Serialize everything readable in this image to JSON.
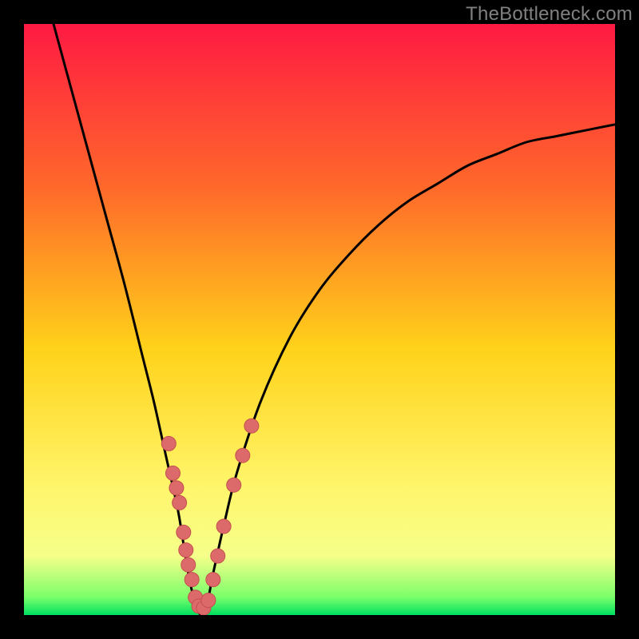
{
  "watermark": "TheBottleneck.com",
  "colors": {
    "frame": "#000000",
    "grad_top": "#ff1a43",
    "grad_upper": "#ff6a2a",
    "grad_mid": "#ffd21a",
    "grad_low": "#fff56a",
    "grad_band": "#f6ff8a",
    "grad_bottom": "#00e060",
    "curve": "#000000",
    "dot_fill": "#dd6a6a",
    "dot_stroke": "#c44f4f"
  },
  "chart_data": {
    "type": "line",
    "title": "",
    "xlabel": "",
    "ylabel": "",
    "xlim": [
      0,
      100
    ],
    "ylim": [
      0,
      100
    ],
    "series": [
      {
        "name": "bottleneck-curve",
        "x": [
          5,
          8,
          11,
          14,
          17,
          20,
          22,
          24,
          26,
          27,
          28,
          29,
          30,
          31,
          32,
          34,
          36,
          40,
          45,
          50,
          55,
          60,
          65,
          70,
          75,
          80,
          85,
          90,
          95,
          100
        ],
        "y": [
          100,
          89,
          78,
          67,
          56,
          44,
          36,
          27,
          18,
          12,
          6,
          2,
          0,
          2,
          7,
          16,
          24,
          36,
          47,
          55,
          61,
          66,
          70,
          73,
          76,
          78,
          80,
          81,
          82,
          83
        ]
      }
    ],
    "markers": [
      {
        "x": 24.5,
        "y": 29
      },
      {
        "x": 25.2,
        "y": 24
      },
      {
        "x": 25.8,
        "y": 21.5
      },
      {
        "x": 26.3,
        "y": 19
      },
      {
        "x": 27.0,
        "y": 14
      },
      {
        "x": 27.4,
        "y": 11
      },
      {
        "x": 27.8,
        "y": 8.5
      },
      {
        "x": 28.4,
        "y": 6
      },
      {
        "x": 29.0,
        "y": 3
      },
      {
        "x": 29.6,
        "y": 1.5
      },
      {
        "x": 30.4,
        "y": 1.2
      },
      {
        "x": 31.2,
        "y": 2.5
      },
      {
        "x": 32.0,
        "y": 6
      },
      {
        "x": 32.8,
        "y": 10
      },
      {
        "x": 33.8,
        "y": 15
      },
      {
        "x": 35.5,
        "y": 22
      },
      {
        "x": 37.0,
        "y": 27
      },
      {
        "x": 38.5,
        "y": 32
      }
    ],
    "marker_radius": 9
  }
}
